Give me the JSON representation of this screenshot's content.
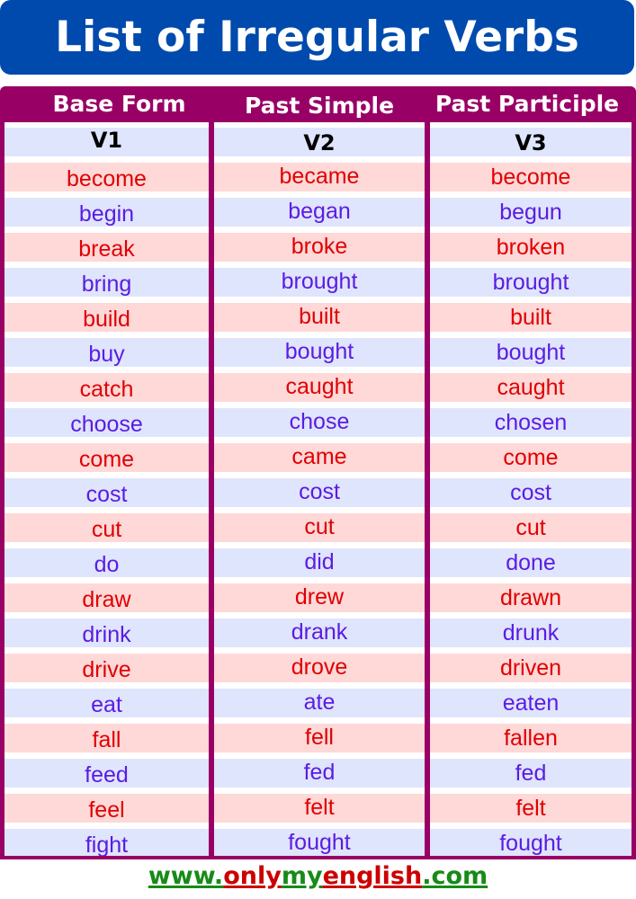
{
  "title": "List of Irregular Verbs",
  "headers": [
    "Base Form",
    "Past Simple",
    "Past Participle"
  ],
  "subheaders": [
    "V1",
    "V2",
    "V3"
  ],
  "colors": {
    "title_bg": "#004aad",
    "header_bg": "#990066",
    "row_blue_bg": "#dfe5fc",
    "row_red_bg": "#ffd8d8",
    "text_blue": "#5b1ce4",
    "text_red": "#e00000",
    "footer_green": "#188a18",
    "footer_red": "#cc0000"
  },
  "verbs": [
    [
      "become",
      "became",
      "become"
    ],
    [
      "begin",
      "began",
      "begun"
    ],
    [
      "break",
      "broke",
      "broken"
    ],
    [
      "bring",
      "brought",
      "brought"
    ],
    [
      "build",
      "built",
      "built"
    ],
    [
      "buy",
      "bought",
      "bought"
    ],
    [
      "catch",
      "caught",
      "caught"
    ],
    [
      "choose",
      "chose",
      "chosen"
    ],
    [
      "come",
      "came",
      "come"
    ],
    [
      "cost",
      "cost",
      "cost"
    ],
    [
      "cut",
      "cut",
      "cut"
    ],
    [
      "do",
      "did",
      "done"
    ],
    [
      "draw",
      "drew",
      "drawn"
    ],
    [
      "drink",
      "drank",
      "drunk"
    ],
    [
      "drive",
      "drove",
      "driven"
    ],
    [
      "eat",
      "ate",
      "eaten"
    ],
    [
      "fall",
      "fell",
      "fallen"
    ],
    [
      "feed",
      "fed",
      "fed"
    ],
    [
      "feel",
      "felt",
      "felt"
    ],
    [
      "fight",
      "fought",
      "fought"
    ]
  ],
  "footer": {
    "parts": [
      {
        "text": "www.",
        "color": "green"
      },
      {
        "text": "only",
        "color": "red"
      },
      {
        "text": "my",
        "color": "green"
      },
      {
        "text": "english",
        "color": "red"
      },
      {
        "text": ".com",
        "color": "green"
      }
    ]
  }
}
